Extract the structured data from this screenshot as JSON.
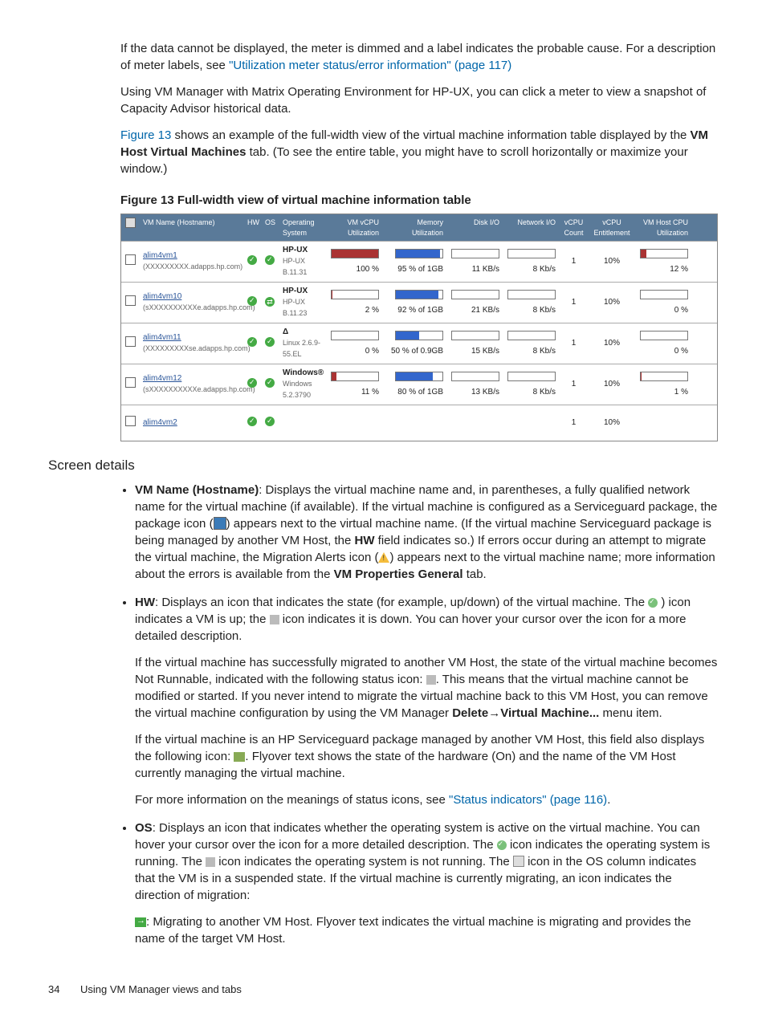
{
  "intro": {
    "p1a": "If the data cannot be displayed, the meter is dimmed and a label indicates the probable cause. For a description of meter labels, see ",
    "p1_link": "\"Utilization meter status/error information\" (page 117)",
    "p2": "Using VM Manager with Matrix Operating Environment for HP-UX, you can click a meter to view a snapshot of Capacity Advisor historical data.",
    "p3_link": "Figure 13",
    "p3a": " shows an example of the full-width view of the virtual machine information table displayed by the ",
    "p3_bold": "VM Host Virtual Machines",
    "p3b": " tab. (To see the entire table, you might have to scroll horizontally or maximize your window.)"
  },
  "figure_title": "Figure 13 Full-width view of virtual machine information table",
  "table": {
    "headers": {
      "name": "VM Name (Hostname)",
      "hw": "HW",
      "os": "OS",
      "opsys": "Operating System",
      "vcpu": "VM vCPU Utilization",
      "mem": "Memory Utilization",
      "disk": "Disk I/O",
      "net": "Network I/O",
      "cnt": "vCPU Count",
      "ent": "vCPU Entitlement",
      "host": "VM Host CPU Utilization"
    },
    "rows": [
      {
        "name": "alim4vm1",
        "sub": "(XXXXXXXXX.adapps.hp.com)",
        "os_label": "HP-UX",
        "os_sub": "HP-UX B.11.31",
        "vcpu": "100 %",
        "vcpu_pct": 100,
        "mem": "95 % of 1GB",
        "mem_pct": 95,
        "disk": "11 KB/s",
        "net": "8 Kb/s",
        "cnt": "1",
        "ent": "10%",
        "host": "12 %",
        "host_pct": 12,
        "migrating": false
      },
      {
        "name": "alim4vm10",
        "sub": "(sXXXXXXXXXXe.adapps.hp.com)",
        "os_label": "HP-UX",
        "os_sub": "HP-UX B.11.23",
        "vcpu": "2 %",
        "vcpu_pct": 2,
        "mem": "92 % of 1GB",
        "mem_pct": 92,
        "disk": "21 KB/s",
        "net": "8 Kb/s",
        "cnt": "1",
        "ent": "10%",
        "host": "0 %",
        "host_pct": 0,
        "migrating": true
      },
      {
        "name": "alim4vm11",
        "sub": "(XXXXXXXXXse.adapps.hp.com)",
        "os_label": "Δ",
        "os_sub": "Linux 2.6.9-55.EL",
        "vcpu": "0 %",
        "vcpu_pct": 0,
        "mem": "50 % of 0.9GB",
        "mem_pct": 50,
        "disk": "15 KB/s",
        "net": "8 Kb/s",
        "cnt": "1",
        "ent": "10%",
        "host": "0 %",
        "host_pct": 0,
        "migrating": false
      },
      {
        "name": "alim4vm12",
        "sub": "(sXXXXXXXXXXe.adapps.hp.com)",
        "os_label": "Windows®",
        "os_sub": "Windows 5.2.3790",
        "vcpu": "11 %",
        "vcpu_pct": 11,
        "mem": "80 % of 1GB",
        "mem_pct": 80,
        "disk": "13 KB/s",
        "net": "8 Kb/s",
        "cnt": "1",
        "ent": "10%",
        "host": "1 %",
        "host_pct": 1,
        "migrating": false
      }
    ],
    "partial_row_name": "alim4vm2"
  },
  "section_title": "Screen details",
  "bullets": {
    "b1": {
      "lead": "VM Name (Hostname)",
      "t1": ": Displays the virtual machine name and, in parentheses, a fully qualified network name for the virtual machine (if available). If the virtual machine is configured as a Serviceguard package, the package icon (",
      "t2": ") appears next to the virtual machine name. (If the virtual machine Serviceguard package is being managed by another VM Host, the ",
      "hw": "HW",
      "t3": " field indicates so.) If errors occur during an attempt to migrate the virtual machine, the Migration Alerts icon (",
      "t4": ") appears next to the virtual machine name; more information about the errors is available from the ",
      "tab": "VM Properties General",
      "t5": " tab."
    },
    "b2": {
      "lead": "HW",
      "t1": ": Displays an icon that indicates the state (for example, up/down) of the virtual machine. The ",
      "t2": " ) icon indicates a VM is up; the ",
      "t3": " icon indicates it is down. You can hover your cursor over the icon for a more detailed description.",
      "p2a": "If the virtual machine has successfully migrated to another VM Host, the state of the virtual machine becomes Not Runnable, indicated with the following status icon: ",
      "p2b": ". This means that the virtual machine cannot be modified or started. If you never intend to migrate the virtual machine back to this VM Host, you can remove the virtual machine configuration by using the VM Manager ",
      "menu1": "Delete",
      "arrow": "→",
      "menu2": "Virtual Machine...",
      "p2c": " menu item.",
      "p3a": "If the virtual machine is an HP Serviceguard package managed by another VM Host, this field also displays the following icon: ",
      "p3b": ". Flyover text shows the state of the hardware (On) and the name of the VM Host currently managing the virtual machine.",
      "p4a": "For more information on the meanings of status icons, see ",
      "p4_link": "\"Status indicators\" (page 116)",
      "p4b": "."
    },
    "b3": {
      "lead": "OS",
      "t1": ": Displays an icon that indicates whether the operating system is active on the virtual machine. You can hover your cursor over the icon for a more detailed description. The ",
      "t2": " icon indicates the operating system is running. The ",
      "t3": " icon indicates the operating system is not running. The ",
      "t4": " icon in the OS column indicates that the VM is in a suspended state. If the virtual machine is currently migrating, an icon indicates the direction of migration:",
      "p2a": ": Migrating to another VM Host. Flyover text indicates the virtual machine is migrating and provides the name of the target VM Host."
    }
  },
  "footer": {
    "page": "34",
    "title": "Using VM Manager views and tabs"
  }
}
